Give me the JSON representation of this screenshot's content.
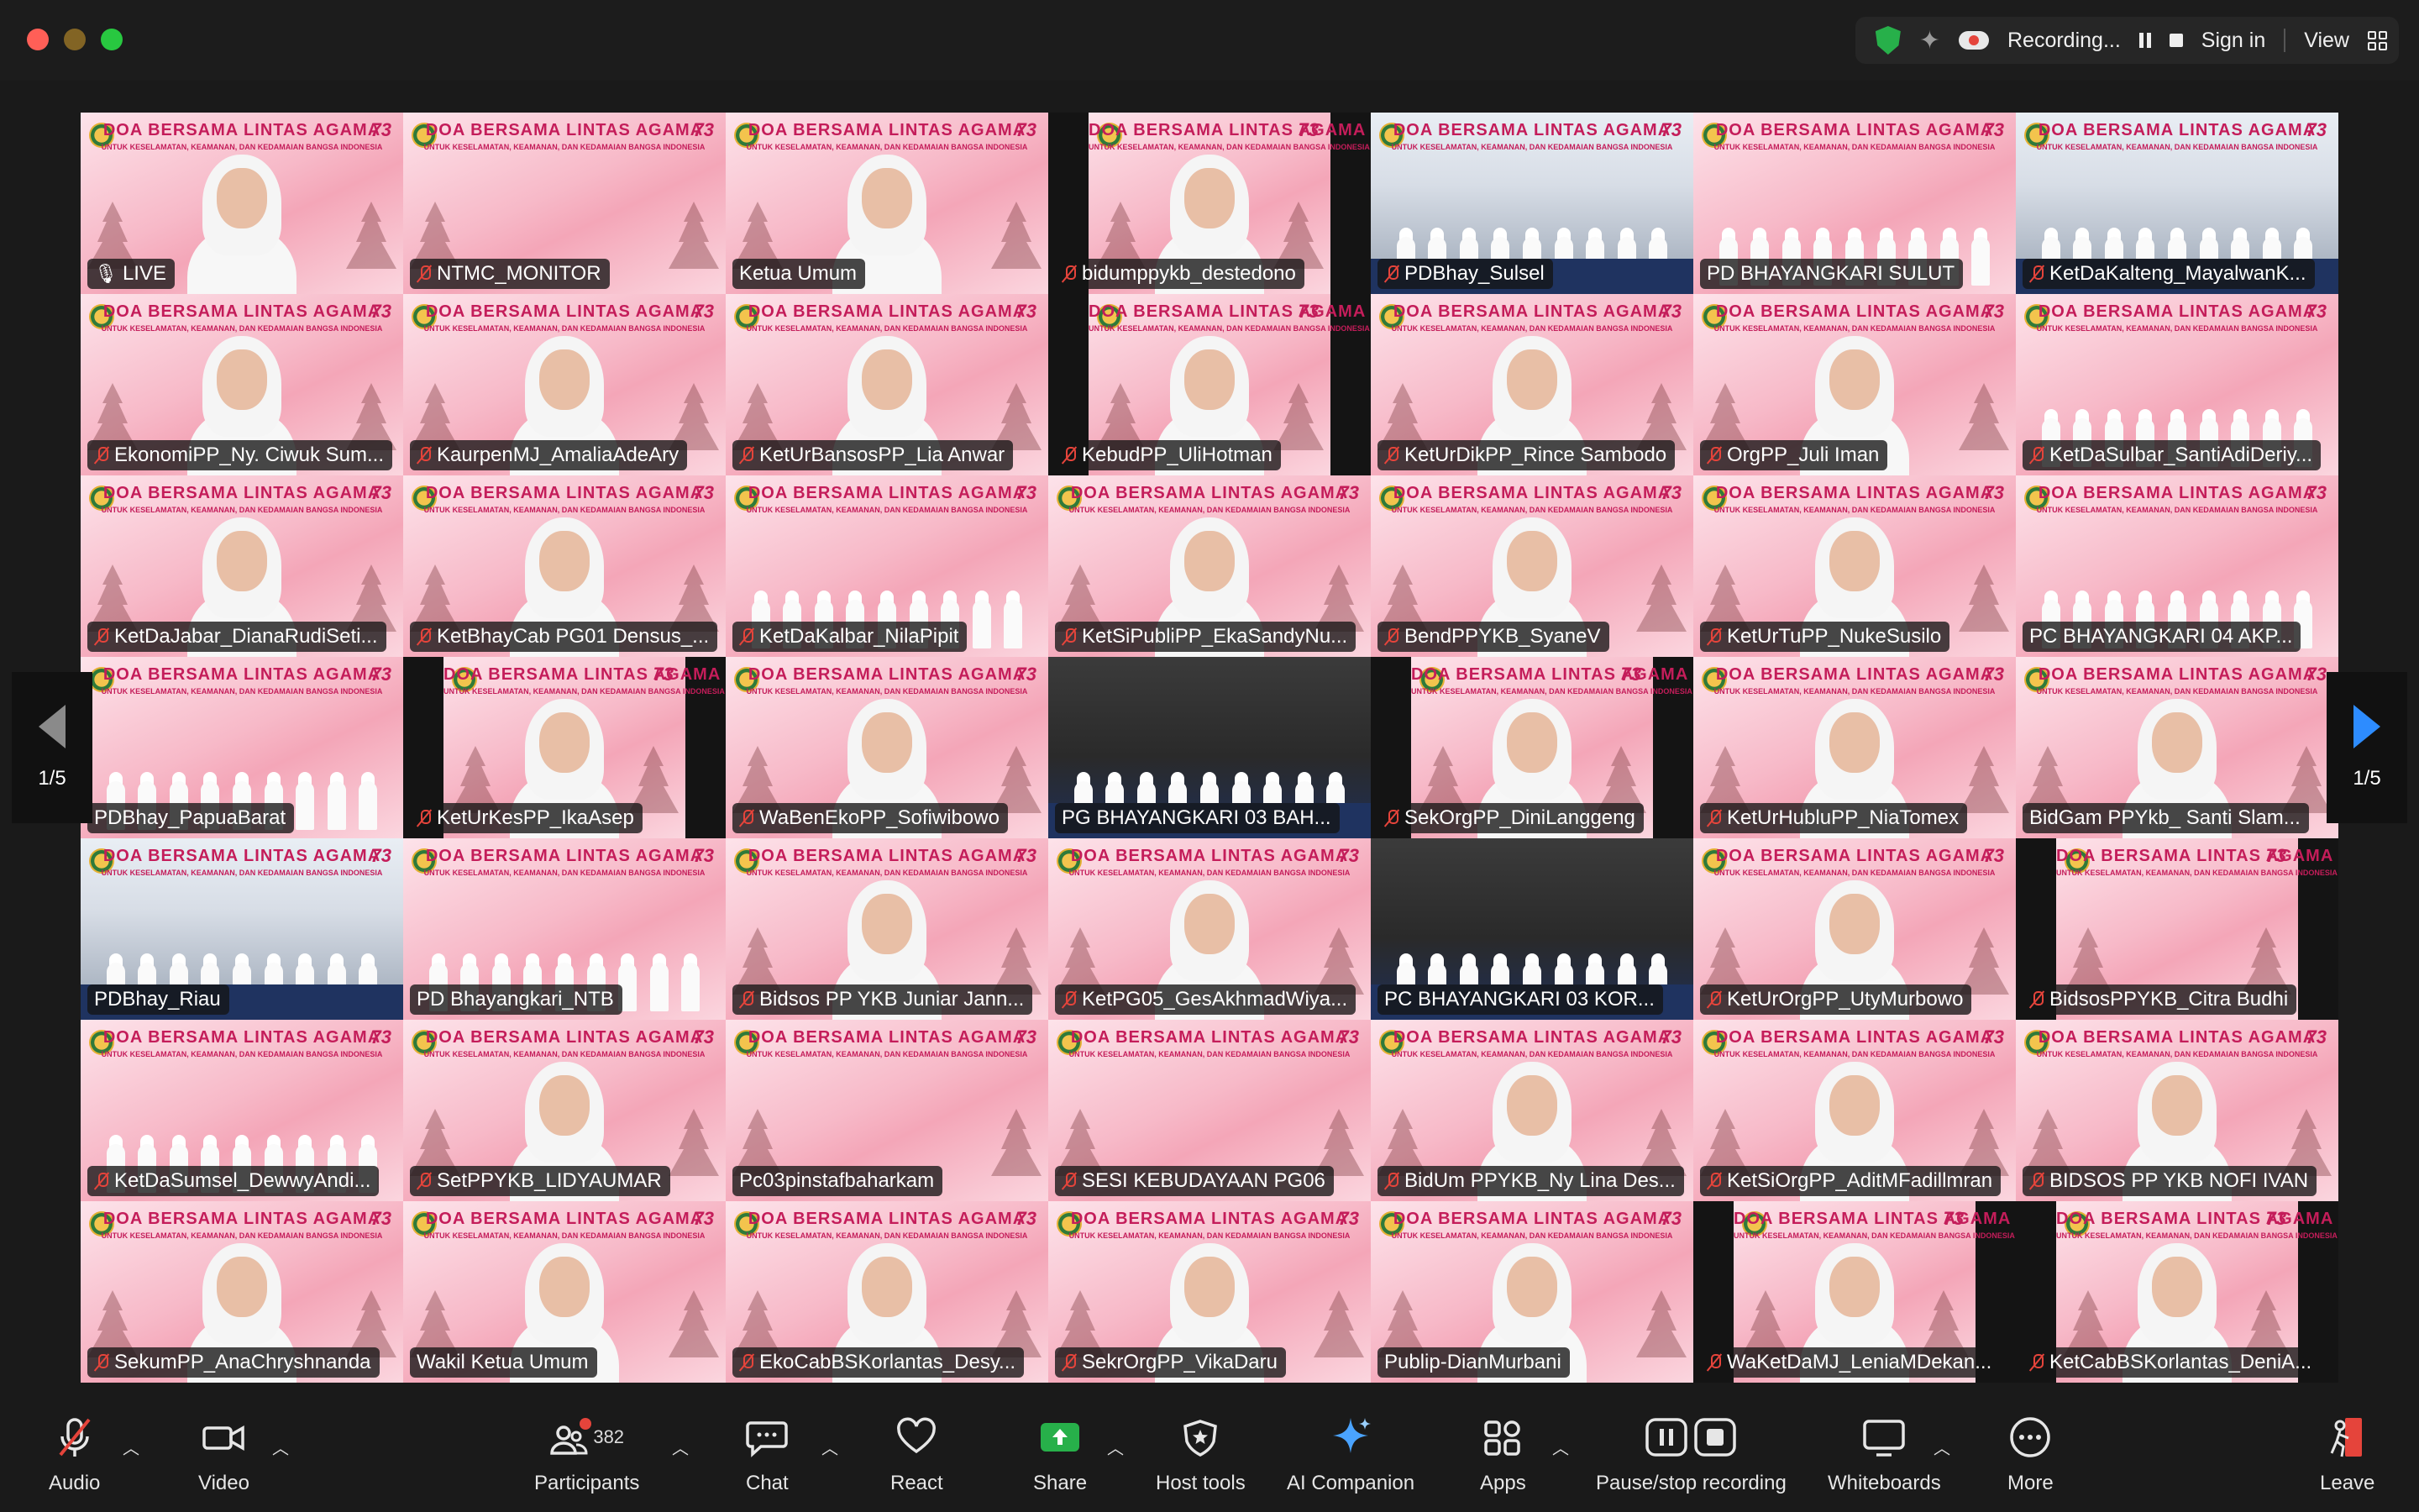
{
  "topbar": {
    "recording_label": "Recording...",
    "sign_in_label": "Sign in",
    "view_label": "View"
  },
  "gallery": {
    "page_label_left": "1/5",
    "page_label_right": "1/5",
    "banner_title": "DOA BERSAMA LINTAS AGAMA",
    "banner_subtitle": "UNTUK KESELAMATAN, KEAMANAN, DAN KEDAMAIAN BANGSA INDONESIA",
    "badge": "73",
    "live_label": "LIVE",
    "tiles": [
      {
        "name": "",
        "live": true,
        "kind": "person",
        "active": true
      },
      {
        "name": "NTMC_MONITOR",
        "kind": "banner"
      },
      {
        "name": "Ketua Umum",
        "kind": "person",
        "unmuted": true
      },
      {
        "name": "bidumppykb_destedono",
        "kind": "person",
        "narrow": true
      },
      {
        "name": "PDBhay_Sulsel",
        "kind": "hall"
      },
      {
        "name": "PD BHAYANGKARI SULUT",
        "kind": "crowd",
        "unmuted": true
      },
      {
        "name": "KetDaKalteng_MayalwanK...",
        "kind": "hall"
      },
      {
        "name": "EkonomiPP_Ny. Ciwuk Sum...",
        "kind": "person"
      },
      {
        "name": "KaurpenMJ_AmaliaAdeAry",
        "kind": "person"
      },
      {
        "name": "KetUrBansosPP_Lia Anwar",
        "kind": "person"
      },
      {
        "name": "KebudPP_UliHotman",
        "kind": "person",
        "narrow": true
      },
      {
        "name": "KetUrDikPP_Rince Sambodo",
        "kind": "person"
      },
      {
        "name": "OrgPP_Juli Iman",
        "kind": "person"
      },
      {
        "name": "KetDaSulbar_SantiAdiDeriy...",
        "kind": "crowd"
      },
      {
        "name": "KetDaJabar_DianaRudiSeti...",
        "kind": "person"
      },
      {
        "name": "KetBhayCab PG01 Densus_...",
        "kind": "person"
      },
      {
        "name": "KetDaKalbar_NilaPipit",
        "kind": "crowd"
      },
      {
        "name": "KetSiPubliPP_EkaSandyNu...",
        "kind": "person"
      },
      {
        "name": "BendPPYKB_SyaneV",
        "kind": "person"
      },
      {
        "name": "KetUrTuPP_NukeSusilo",
        "kind": "person"
      },
      {
        "name": "PC BHAYANGKARI 04 AKP...",
        "kind": "crowd",
        "unmuted": true
      },
      {
        "name": "PDBhay_PapuaBarat",
        "kind": "crowd",
        "unmuted": true
      },
      {
        "name": "KetUrKesPP_IkaAsep",
        "kind": "person",
        "narrow": true
      },
      {
        "name": "WaBenEkoPP_Sofiwibowo",
        "kind": "person"
      },
      {
        "name": "PG BHAYANGKARI 03 BAH...",
        "kind": "dark",
        "unmuted": true
      },
      {
        "name": "SekOrgPP_DiniLanggeng",
        "kind": "person",
        "narrow": true
      },
      {
        "name": "KetUrHubluPP_NiaTomex",
        "kind": "person"
      },
      {
        "name": "BidGam PPYkb_ Santi Slam...",
        "kind": "person",
        "unmuted": true
      },
      {
        "name": "PDBhay_Riau",
        "kind": "hall",
        "unmuted": true
      },
      {
        "name": "PD Bhayangkari_NTB",
        "kind": "crowd",
        "unmuted": true
      },
      {
        "name": "Bidsos PP YKB Juniar Jann...",
        "kind": "person"
      },
      {
        "name": "KetPG05_GesAkhmadWiya...",
        "kind": "person"
      },
      {
        "name": "PC BHAYANGKARI 03 KOR...",
        "kind": "dark",
        "unmuted": true
      },
      {
        "name": "KetUrOrgPP_UtyMurbowo",
        "kind": "person"
      },
      {
        "name": "BidsosPPYKB_Citra Budhi",
        "kind": "banner",
        "narrow": true
      },
      {
        "name": "KetDaSumsel_DewwyAndi...",
        "kind": "crowd"
      },
      {
        "name": "SetPPYKB_LIDYAUMAR",
        "kind": "person"
      },
      {
        "name": "Pc03pinstafbaharkam",
        "kind": "banner",
        "unmuted": true
      },
      {
        "name": "SESI KEBUDAYAAN PG06",
        "kind": "banner"
      },
      {
        "name": "BidUm PPYKB_Ny Lina Des...",
        "kind": "person"
      },
      {
        "name": "KetSiOrgPP_AditMFadillmran",
        "kind": "person"
      },
      {
        "name": "BIDSOS PP YKB NOFI IVAN",
        "kind": "person"
      },
      {
        "name": "SekumPP_AnaChryshnanda",
        "kind": "person"
      },
      {
        "name": "Wakil Ketua Umum",
        "kind": "person",
        "unmuted": true
      },
      {
        "name": "EkoCabBSKorlantas_Desy...",
        "kind": "person"
      },
      {
        "name": "SekrOrgPP_VikaDaru",
        "kind": "person"
      },
      {
        "name": "Publip-DianMurbani",
        "kind": "person",
        "unmuted": true
      },
      {
        "name": "WaKetDaMJ_LeniaMDekan...",
        "kind": "person",
        "narrow": true
      },
      {
        "name": "KetCabBSKorlantas_DeniA...",
        "kind": "person",
        "narrow": true
      }
    ]
  },
  "toolbar": {
    "audio_label": "Audio",
    "video_label": "Video",
    "participants_label": "Participants",
    "participants_count": "382",
    "chat_label": "Chat",
    "react_label": "React",
    "share_label": "Share",
    "host_tools_label": "Host tools",
    "ai_companion_label": "AI Companion",
    "apps_label": "Apps",
    "pause_stop_label": "Pause/stop recording",
    "whiteboards_label": "Whiteboards",
    "more_label": "More",
    "leave_label": "Leave"
  },
  "colors": {
    "active_speaker": "#3ddc4a",
    "share_green": "#27b04a",
    "muted_red": "#e5443b",
    "nav_blue": "#2d8cff"
  }
}
